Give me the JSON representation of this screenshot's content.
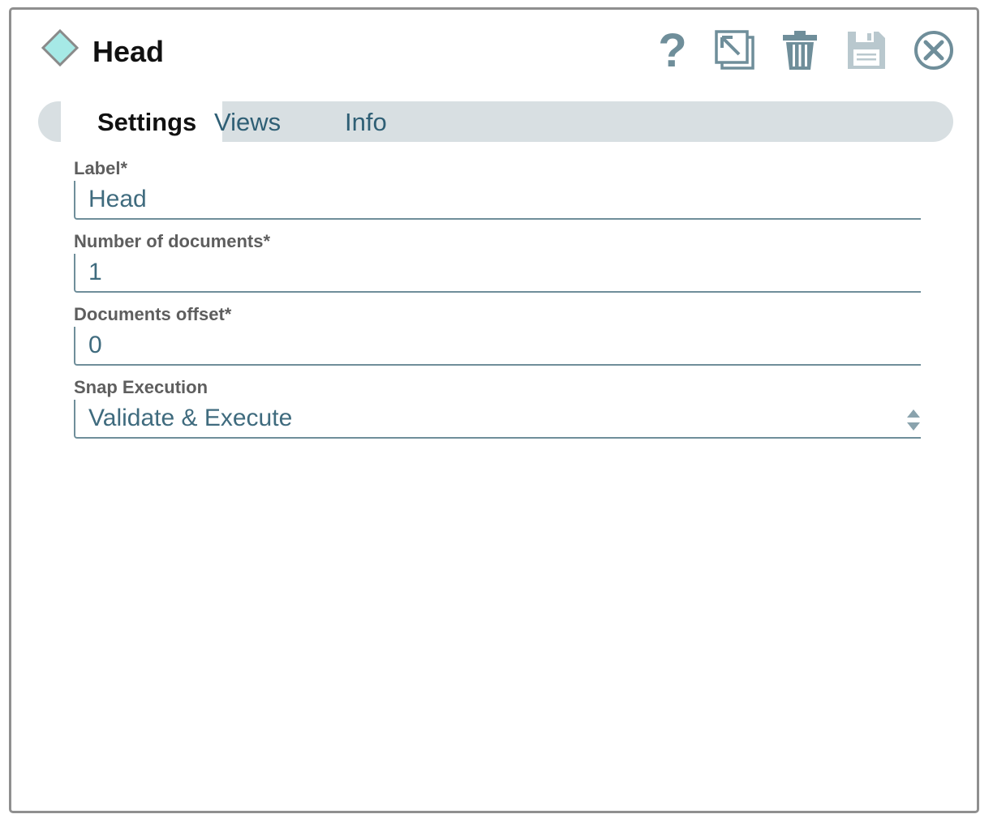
{
  "dialog": {
    "title": "Head",
    "snap_icon": "diamond-icon",
    "toolbar": [
      {
        "name": "help",
        "icon": "question-mark-icon"
      },
      {
        "name": "export",
        "icon": "export-icon"
      },
      {
        "name": "delete",
        "icon": "trash-icon"
      },
      {
        "name": "save",
        "icon": "floppy-disk-icon"
      },
      {
        "name": "close",
        "icon": "close-circle-icon"
      }
    ]
  },
  "tabs": [
    {
      "label": "Settings",
      "active": true
    },
    {
      "label": "Views",
      "active": false
    },
    {
      "label": "Info",
      "active": false
    }
  ],
  "fields": {
    "label": {
      "label": "Label*",
      "value": "Head"
    },
    "num_docs": {
      "label": "Number of documents*",
      "value": "1"
    },
    "offset": {
      "label": "Documents offset*",
      "value": "0"
    },
    "snap_execution": {
      "label": "Snap Execution",
      "value": "Validate & Execute"
    }
  },
  "colors": {
    "accent": "#6f8e9a",
    "tab_bar": "#d8dfe2",
    "snap_fill": "#a6e9e6",
    "text_value": "#3f6b7e"
  }
}
